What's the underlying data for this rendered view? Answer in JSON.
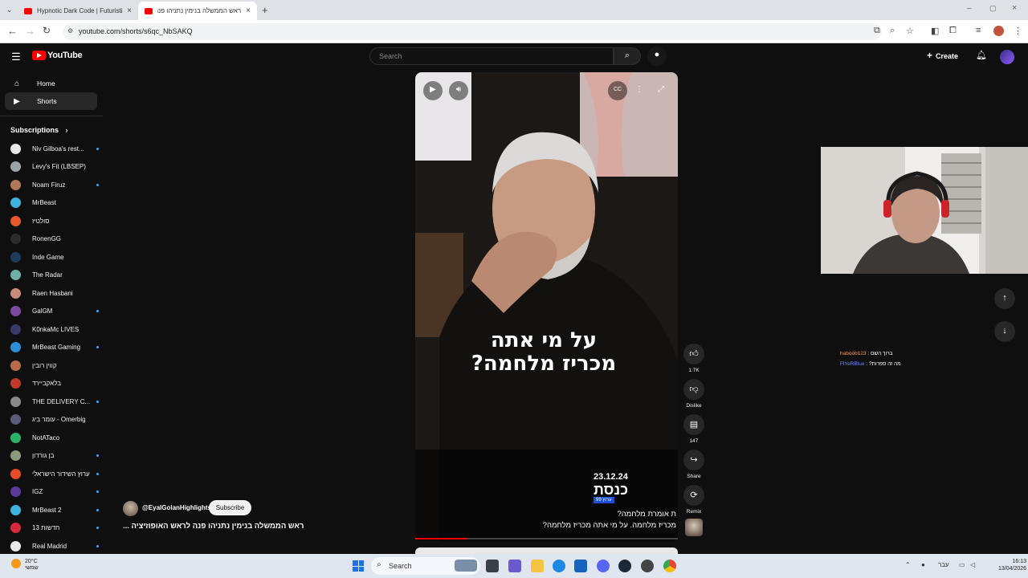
{
  "browser": {
    "tabs": [
      {
        "title": "Hypnotic Dark Code | Futuristic",
        "active": false
      },
      {
        "title": "ראש הממשלה בנימין נתניהו פנה",
        "active": true
      }
    ],
    "url": "youtube.com/shorts/s6qc_NbSAKQ"
  },
  "youtube": {
    "logo_text": "YouTube",
    "search_placeholder": "Search",
    "create_label": "Create"
  },
  "sidebar": {
    "nav": [
      {
        "label": "Home",
        "icon": "home-icon"
      },
      {
        "label": "Shorts",
        "icon": "shorts-icon"
      }
    ],
    "subscriptions_heading": "Subscriptions",
    "subscriptions": [
      {
        "name": "Niv Gilboa's rest...",
        "new": true,
        "color": "#e9e9e9"
      },
      {
        "name": "Levy's Fit (LBSEP)",
        "new": false,
        "color": "#9aa3a8"
      },
      {
        "name": "Noam Firuz",
        "new": true,
        "color": "#b07a5a"
      },
      {
        "name": "MrBeast",
        "new": false,
        "color": "#3fb3e0"
      },
      {
        "name": "סולטיז",
        "new": false,
        "color": "#e45a2a"
      },
      {
        "name": "RonenGG",
        "new": false,
        "color": "#2c2c2c"
      },
      {
        "name": "Inde Game",
        "new": false,
        "color": "#1f3b5c"
      },
      {
        "name": "The Radar",
        "new": false,
        "color": "#6fb0a8"
      },
      {
        "name": "Raen Hasbani",
        "new": false,
        "color": "#c78b7a"
      },
      {
        "name": "GalGM",
        "new": true,
        "color": "#7a4aa0"
      },
      {
        "name": "K0nkaMc LIVES",
        "new": false,
        "color": "#3a3a6a"
      },
      {
        "name": "MrBeast Gaming",
        "new": true,
        "color": "#2a8fd6"
      },
      {
        "name": "קווין רובין",
        "new": false,
        "color": "#b86a4a"
      },
      {
        "name": "בלאקביירד",
        "new": false,
        "color": "#c0392b"
      },
      {
        "name": "THE DELIVERY C...",
        "new": true,
        "color": "#8a8a8a"
      },
      {
        "name": "עומר ביג - Omerbig",
        "new": false,
        "color": "#5a5a7a"
      },
      {
        "name": "NotATaco",
        "new": false,
        "color": "#2bb36a"
      },
      {
        "name": "בן גורדון",
        "new": true,
        "color": "#8a9a7a"
      },
      {
        "name": "ערוץ השידור הישראלי",
        "new": true,
        "color": "#e84a2a"
      },
      {
        "name": "IGZ",
        "new": true,
        "color": "#5a3a9a"
      },
      {
        "name": "MrBeast 2",
        "new": true,
        "color": "#3fb3e0"
      },
      {
        "name": "13 חדשות",
        "new": true,
        "color": "#d62a3a"
      },
      {
        "name": "Real Madrid",
        "new": true,
        "color": "#e8e8e8"
      }
    ]
  },
  "short": {
    "caption_line1": "על מי אתה",
    "caption_line2": "מכריז מלחמה?",
    "date": "23.12.24",
    "brand": "כנסת",
    "channel_badge": "ערוץ 99",
    "text_line1": "ת אומרת מלחמה?",
    "text_line2": "מכריז מלחמה. על מי אתה מכריז מלחמה?",
    "progress_fraction": 0.2,
    "channel": "@EyalGolanHighlights",
    "subscribe_label": "Subscribe",
    "title": "ראש הממשלה בנימין נתניהו פנה לראש האופוזיציה ..."
  },
  "actions": {
    "likes": "1.7K",
    "dislike_label": "Dislike",
    "comments": "147",
    "share_label": "Share",
    "remix_label": "Remix"
  },
  "chat": [
    {
      "user": "haboob123",
      "text": "ברוך השם"
    },
    {
      "user": "FlYeRBlue",
      "text": "מה זה ספרות?"
    }
  ],
  "taskbar": {
    "temperature": "20°C",
    "weather_text": "שמשי",
    "search_label": "Search",
    "language": "עבר",
    "time": "16:13",
    "date": "13/04/2026"
  }
}
